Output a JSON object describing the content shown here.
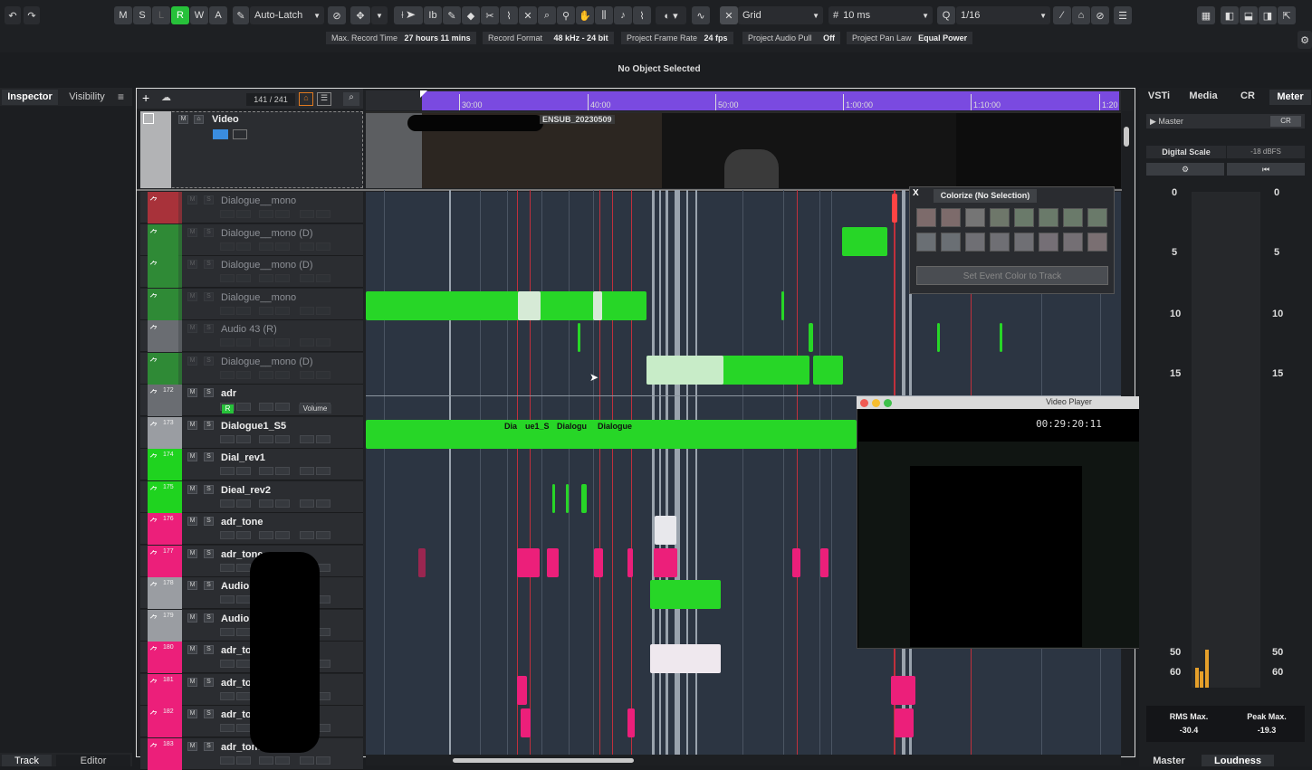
{
  "toolbar": {
    "m": "M",
    "s": "S",
    "l": "L",
    "r": "R",
    "w": "W",
    "a": "A",
    "automation_mode": "Auto-Latch",
    "snap_type": "Grid",
    "grid_size": "10 ms",
    "quantize": "1/16"
  },
  "infobar": {
    "max_record_label": "Max. Record Time",
    "max_record_value": "27 hours 11 mins",
    "record_format_label": "Record Format",
    "record_format_value": "48 kHz - 24 bit",
    "frame_rate_label": "Project Frame Rate",
    "frame_rate_value": "24 fps",
    "audio_pull_label": "Project Audio Pull",
    "audio_pull_value": "Off",
    "pan_law_label": "Project Pan Law",
    "pan_law_value": "Equal Power"
  },
  "status": "No Object Selected",
  "left_tabs": {
    "inspector": "Inspector",
    "visibility": "Visibility"
  },
  "bottom_tabs": {
    "track": "Track",
    "editor": "Editor"
  },
  "tracklist": {
    "counter": "141 / 241"
  },
  "video_track": {
    "name": "Video",
    "clip_label": "ENSUB_20230509"
  },
  "ruler": {
    "labels": [
      "30:00",
      "40:00",
      "50:00",
      "1:00:00",
      "1:10:00",
      "1:20"
    ]
  },
  "tracks": [
    {
      "num": "",
      "name": "Dialogue__mono",
      "dim": true,
      "color": "#a8323a"
    },
    {
      "num": "",
      "name": "Dialogue__mono (D)",
      "dim": true,
      "color": "#2f8a36"
    },
    {
      "num": "",
      "name": "Dialogue__mono (D)",
      "dim": true,
      "color": "#2f8a36"
    },
    {
      "num": "",
      "name": "Dialogue__mono",
      "dim": true,
      "color": "#2f8a36"
    },
    {
      "num": "",
      "name": "Audio 43 (R)",
      "dim": true,
      "color": "#6a6d72"
    },
    {
      "num": "",
      "name": "Dialogue__mono (D)",
      "dim": true,
      "color": "#2f8a36"
    },
    {
      "num": "172",
      "name": "adr",
      "dim": false,
      "color": "#6a6d72"
    },
    {
      "num": "173",
      "name": "Dialogue1_S5",
      "dim": false,
      "color": "#9a9da2"
    },
    {
      "num": "174",
      "name": "Dial_rev1",
      "dim": false,
      "color": "#1fd31f"
    },
    {
      "num": "175",
      "name": "Dieal_rev2",
      "dim": false,
      "color": "#1fd31f"
    },
    {
      "num": "176",
      "name": "adr_tone",
      "dim": false,
      "color": "#ec1f7a"
    },
    {
      "num": "177",
      "name": "adr_tone",
      "dim": false,
      "color": "#ec1f7a"
    },
    {
      "num": "178",
      "name": "Audio",
      "dim": false,
      "color": "#9a9da2"
    },
    {
      "num": "179",
      "name": "Audio",
      "dim": false,
      "color": "#9a9da2"
    },
    {
      "num": "180",
      "name": "adr_to",
      "dim": false,
      "color": "#ec1f7a"
    },
    {
      "num": "181",
      "name": "adr_to",
      "dim": false,
      "color": "#ec1f7a"
    },
    {
      "num": "182",
      "name": "adr_to",
      "dim": false,
      "color": "#ec1f7a"
    },
    {
      "num": "183",
      "name": "adr_tone",
      "dim": false,
      "color": "#ec1f7a"
    }
  ],
  "adr_volume_label": "Volume",
  "clip_labels": {
    "a": "Dia",
    "b": "ue1_S",
    "c": "Dialogu",
    "d": "Dialogue"
  },
  "colorize": {
    "title": "Colorize (No Selection)",
    "close": "X",
    "button": "Set Event Color to Track"
  },
  "video_player": {
    "title": "Video Player",
    "timecode": "00:29:20:11"
  },
  "right_tabs": {
    "vsti": "VSTi",
    "media": "Media",
    "cr": "CR",
    "meter": "Meter"
  },
  "meter": {
    "master": "Master",
    "cr": "CR",
    "digital_scale": "Digital Scale",
    "digital_scale_value": "-18 dBFS",
    "scale": [
      "0",
      "5",
      "10",
      "15",
      "50",
      "60"
    ],
    "rms_label": "RMS Max.",
    "rms_value": "-30.4",
    "peak_label": "Peak Max.",
    "peak_value": "-19.3"
  },
  "right_bottom_tabs": {
    "master": "Master",
    "loudness": "Loudness"
  }
}
